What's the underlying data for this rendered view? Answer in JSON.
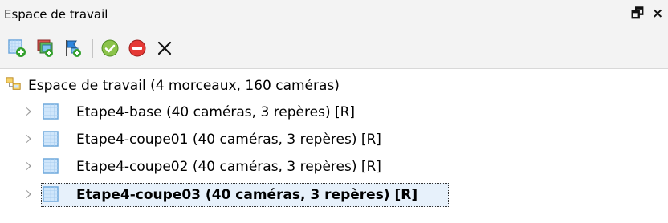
{
  "window": {
    "title": "Espace de travail",
    "float_glyph": "🗗",
    "close_glyph": "×"
  },
  "toolbar": {
    "buttons": [
      {
        "name": "add-chunk-button",
        "icon": "add-chunk-icon"
      },
      {
        "name": "add-photos-button",
        "icon": "add-photos-icon"
      },
      {
        "name": "add-markers-button",
        "icon": "add-markers-icon"
      },
      {
        "name": "enable-button",
        "icon": "check-icon"
      },
      {
        "name": "disable-button",
        "icon": "minus-circle-icon"
      },
      {
        "name": "remove-button",
        "icon": "close-icon",
        "glyph": "✕"
      }
    ]
  },
  "tree": {
    "root": {
      "label": "Espace de travail (4 morceaux, 160 caméras)",
      "icon": "workspace-icon"
    },
    "chunks": [
      {
        "label": "Etape4-base (40 caméras, 3 repères) [R]",
        "selected": false,
        "icon": "chunk-icon"
      },
      {
        "label": "Etape4-coupe01 (40 caméras, 3 repères) [R]",
        "selected": false,
        "icon": "chunk-icon"
      },
      {
        "label": "Etape4-coupe02 (40 caméras, 3 repères) [R]",
        "selected": false,
        "icon": "chunk-icon"
      },
      {
        "label": "Etape4-coupe03 (40 caméras, 3 repères) [R]",
        "selected": true,
        "icon": "chunk-icon"
      }
    ]
  },
  "colors": {
    "chunk_icon_fill": "#cfe6fb",
    "chunk_icon_border": "#6fa8dc",
    "workspace_icon": "#e8b43a",
    "add_green": "#33a02c",
    "check_green": "#4caf50",
    "stop_red": "#e53935"
  }
}
